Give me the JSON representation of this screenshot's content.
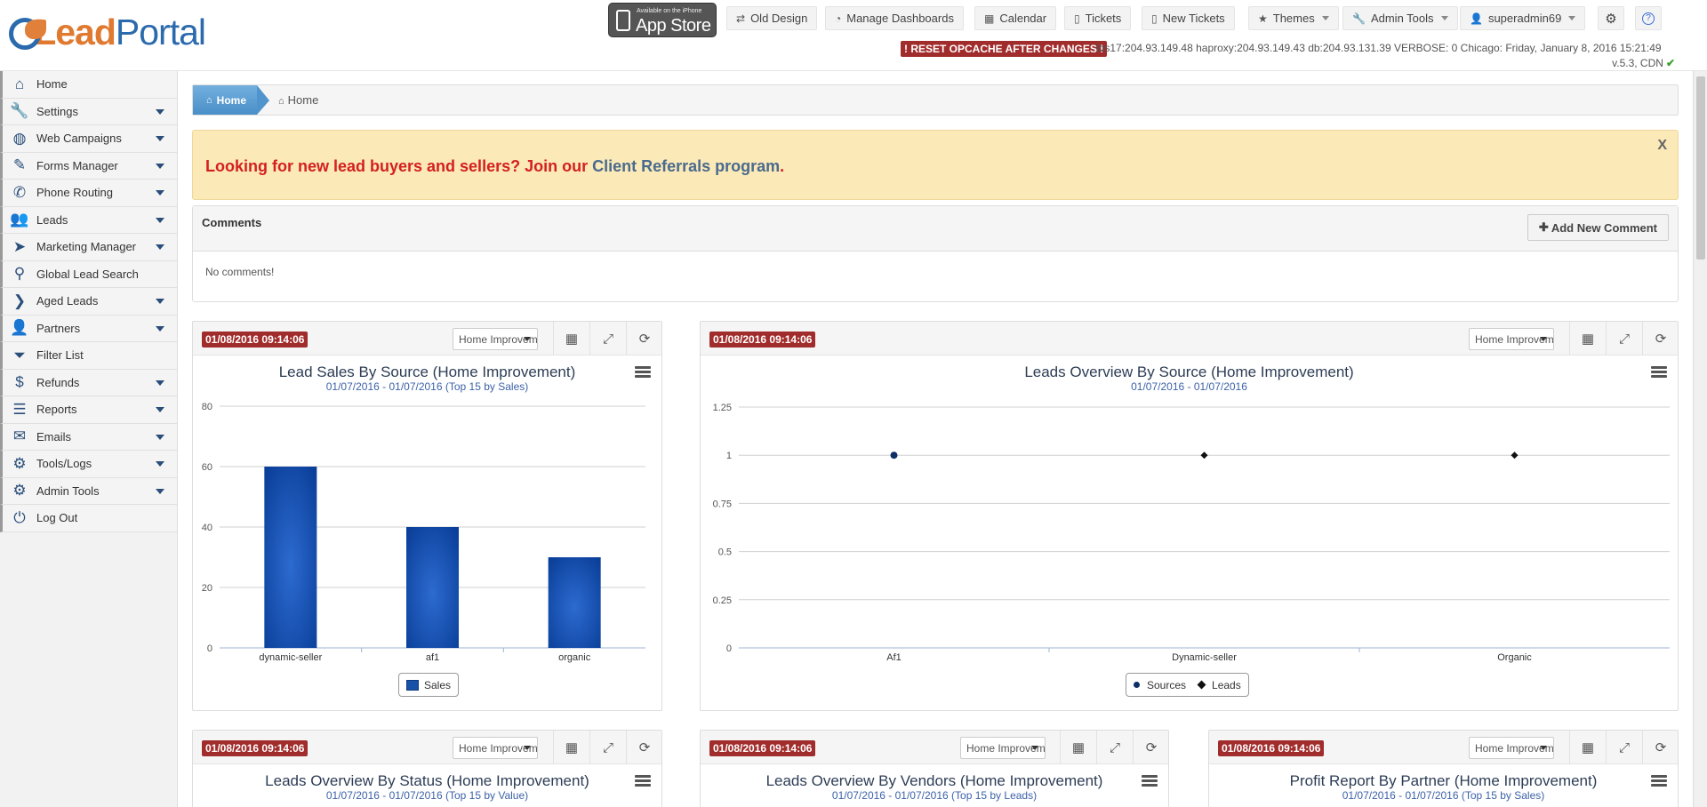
{
  "header": {
    "logo": {
      "part1": "Lead",
      "part2": "Portal"
    },
    "appstore": {
      "small": "Available on the iPhone",
      "big": "App Store"
    },
    "buttons": [
      {
        "label": "Old Design",
        "icon": "exchange-icon"
      },
      {
        "label": "Manage Dashboards",
        "icon": "dashboard-icon"
      },
      {
        "label": "Calendar",
        "icon": "calendar-icon"
      },
      {
        "label": "Tickets",
        "icon": "file-icon"
      },
      {
        "label": "New Tickets",
        "icon": "file-icon"
      },
      {
        "label": "Themes",
        "icon": "star-icon"
      },
      {
        "label": "Admin Tools",
        "icon": "wrench-icon"
      },
      {
        "label": "superadmin69",
        "icon": "user-icon"
      }
    ],
    "reset_label": "! RESET OPCACHE AFTER CHANGES !",
    "server_info": "lbs17:204.93.149.48 haproxy:204.93.149.43 db:204.93.131.39 VERBOSE: 0   Chicago: Friday, January 8, 2016 15:21:49",
    "version": "v.5.3, CDN"
  },
  "sidebar": {
    "items": [
      {
        "label": "Home",
        "icon": "home-icon",
        "caret": false
      },
      {
        "label": "Settings",
        "icon": "wrench-icon",
        "caret": true
      },
      {
        "label": "Web Campaigns",
        "icon": "globe-icon",
        "caret": true
      },
      {
        "label": "Forms Manager",
        "icon": "edit-icon",
        "caret": true
      },
      {
        "label": "Phone Routing",
        "icon": "phone-icon",
        "caret": true
      },
      {
        "label": "Leads",
        "icon": "users-icon",
        "caret": true
      },
      {
        "label": "Marketing Manager",
        "icon": "send-icon",
        "caret": true
      },
      {
        "label": "Global Lead Search",
        "icon": "search-icon",
        "caret": false
      },
      {
        "label": "Aged Leads",
        "icon": "chevron-right-icon",
        "caret": true
      },
      {
        "label": "Partners",
        "icon": "partners-icon",
        "caret": true
      },
      {
        "label": "Filter List",
        "icon": "filter-icon",
        "caret": false
      },
      {
        "label": "Refunds",
        "icon": "money-bag-icon",
        "caret": true
      },
      {
        "label": "Reports",
        "icon": "list-icon",
        "caret": true
      },
      {
        "label": "Emails",
        "icon": "envelope-icon",
        "caret": true
      },
      {
        "label": "Tools/Logs",
        "icon": "cog-icon",
        "caret": true
      },
      {
        "label": "Admin Tools",
        "icon": "cog-icon",
        "caret": true
      },
      {
        "label": "Log Out",
        "icon": "power-icon",
        "caret": false
      }
    ]
  },
  "breadcrumb": {
    "home": "Home",
    "current": "Home"
  },
  "alert": {
    "text": "Looking for new lead buyers and sellers? Join our ",
    "link": "Client Referrals program",
    "end": ".",
    "close": "X"
  },
  "comments": {
    "title": "Comments",
    "add_label": "Add New Comment",
    "empty": "No comments!"
  },
  "widgets": [
    {
      "date": "01/08/2016 09:14:06",
      "select": "Home Improvement",
      "title": "Lead Sales By Source (Home Improvement)",
      "subtitle": "01/07/2016 - 01/07/2016 (Top 15 by Sales)"
    },
    {
      "date": "01/08/2016 09:14:06",
      "select": "Home Improvement",
      "title": "Leads Overview By Source (Home Improvement)",
      "subtitle": "01/07/2016 - 01/07/2016"
    },
    {
      "date": "01/08/2016 09:14:06",
      "select": "Home Improvement",
      "title": "Leads Overview By Status (Home Improvement)",
      "subtitle": "01/07/2016 - 01/07/2016 (Top 15 by Value)"
    },
    {
      "date": "01/08/2016 09:14:06",
      "select": "Home Improvement",
      "title": "Leads Overview By Vendors (Home Improvement)",
      "subtitle": "01/07/2016 - 01/07/2016 (Top 15 by Leads)"
    },
    {
      "date": "01/08/2016 09:14:06",
      "select": "Home Improvement",
      "title": "Profit Report By Partner (Home Improvement)",
      "subtitle": "01/07/2016 - 01/07/2016 (Top 15 by Sales)"
    }
  ],
  "colors": {
    "accent": "#4a8fc8",
    "danger": "#a12c2c",
    "bar": "#1752a8",
    "alert_bg": "#fbe9b7"
  },
  "chart_data": [
    {
      "type": "bar",
      "title": "Lead Sales By Source (Home Improvement)",
      "subtitle": "01/07/2016 - 01/07/2016 (Top 15 by Sales)",
      "categories": [
        "dynamic-seller",
        "af1",
        "organic"
      ],
      "yticks": [
        "0",
        "20",
        "40",
        "60",
        "80"
      ],
      "series": [
        {
          "name": "Sales",
          "values": [
            60,
            40,
            30
          ]
        }
      ],
      "ylim": [
        0,
        80
      ],
      "legend": "bottom-center"
    },
    {
      "type": "scatter",
      "title": "Leads Overview By Source (Home Improvement)",
      "subtitle": "01/07/2016 - 01/07/2016",
      "categories": [
        "Af1",
        "Dynamic-seller",
        "Organic"
      ],
      "yticks": [
        "0",
        "0.25",
        "0.5",
        "0.75",
        "1",
        "1.25"
      ],
      "series": [
        {
          "name": "Sources",
          "values": [
            1,
            null,
            null
          ]
        },
        {
          "name": "Leads",
          "values": [
            null,
            1,
            1
          ]
        }
      ],
      "ylim": [
        0,
        1.25
      ],
      "legend": "bottom-center"
    }
  ]
}
